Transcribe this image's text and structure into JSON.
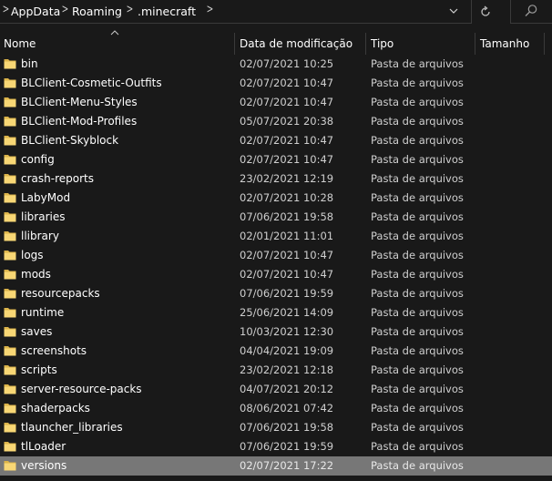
{
  "breadcrumb": {
    "items": [
      "AppData",
      "Roaming",
      ".minecraft"
    ]
  },
  "columns": {
    "name": "Nome",
    "date": "Data de modificação",
    "type": "Tipo",
    "size": "Tamanho"
  },
  "colors": {
    "background": "#191919",
    "selected_row": "#777777",
    "folder_yellow": "#f8d775",
    "divider": "#3a3a3a"
  },
  "files": [
    {
      "name": "bin",
      "date": "02/07/2021 10:25",
      "type": "Pasta de arquivos"
    },
    {
      "name": "BLClient-Cosmetic-Outfits",
      "date": "02/07/2021 10:47",
      "type": "Pasta de arquivos"
    },
    {
      "name": "BLClient-Menu-Styles",
      "date": "02/07/2021 10:47",
      "type": "Pasta de arquivos"
    },
    {
      "name": "BLClient-Mod-Profiles",
      "date": "05/07/2021 20:38",
      "type": "Pasta de arquivos"
    },
    {
      "name": "BLClient-Skyblock",
      "date": "02/07/2021 10:47",
      "type": "Pasta de arquivos"
    },
    {
      "name": "config",
      "date": "02/07/2021 10:47",
      "type": "Pasta de arquivos"
    },
    {
      "name": "crash-reports",
      "date": "23/02/2021 12:19",
      "type": "Pasta de arquivos"
    },
    {
      "name": "LabyMod",
      "date": "02/07/2021 10:28",
      "type": "Pasta de arquivos"
    },
    {
      "name": "libraries",
      "date": "07/06/2021 19:58",
      "type": "Pasta de arquivos"
    },
    {
      "name": "llibrary",
      "date": "02/01/2021 11:01",
      "type": "Pasta de arquivos"
    },
    {
      "name": "logs",
      "date": "02/07/2021 10:47",
      "type": "Pasta de arquivos"
    },
    {
      "name": "mods",
      "date": "02/07/2021 10:47",
      "type": "Pasta de arquivos"
    },
    {
      "name": "resourcepacks",
      "date": "07/06/2021 19:59",
      "type": "Pasta de arquivos"
    },
    {
      "name": "runtime",
      "date": "25/06/2021 14:09",
      "type": "Pasta de arquivos"
    },
    {
      "name": "saves",
      "date": "10/03/2021 12:30",
      "type": "Pasta de arquivos"
    },
    {
      "name": "screenshots",
      "date": "04/04/2021 19:09",
      "type": "Pasta de arquivos"
    },
    {
      "name": "scripts",
      "date": "23/02/2021 12:18",
      "type": "Pasta de arquivos"
    },
    {
      "name": "server-resource-packs",
      "date": "04/07/2021 20:12",
      "type": "Pasta de arquivos"
    },
    {
      "name": "shaderpacks",
      "date": "08/06/2021 07:42",
      "type": "Pasta de arquivos"
    },
    {
      "name": "tlauncher_libraries",
      "date": "07/06/2021 19:58",
      "type": "Pasta de arquivos"
    },
    {
      "name": "tlLoader",
      "date": "07/06/2021 19:59",
      "type": "Pasta de arquivos"
    },
    {
      "name": "versions",
      "date": "02/07/2021 17:22",
      "type": "Pasta de arquivos",
      "selected": true
    }
  ]
}
